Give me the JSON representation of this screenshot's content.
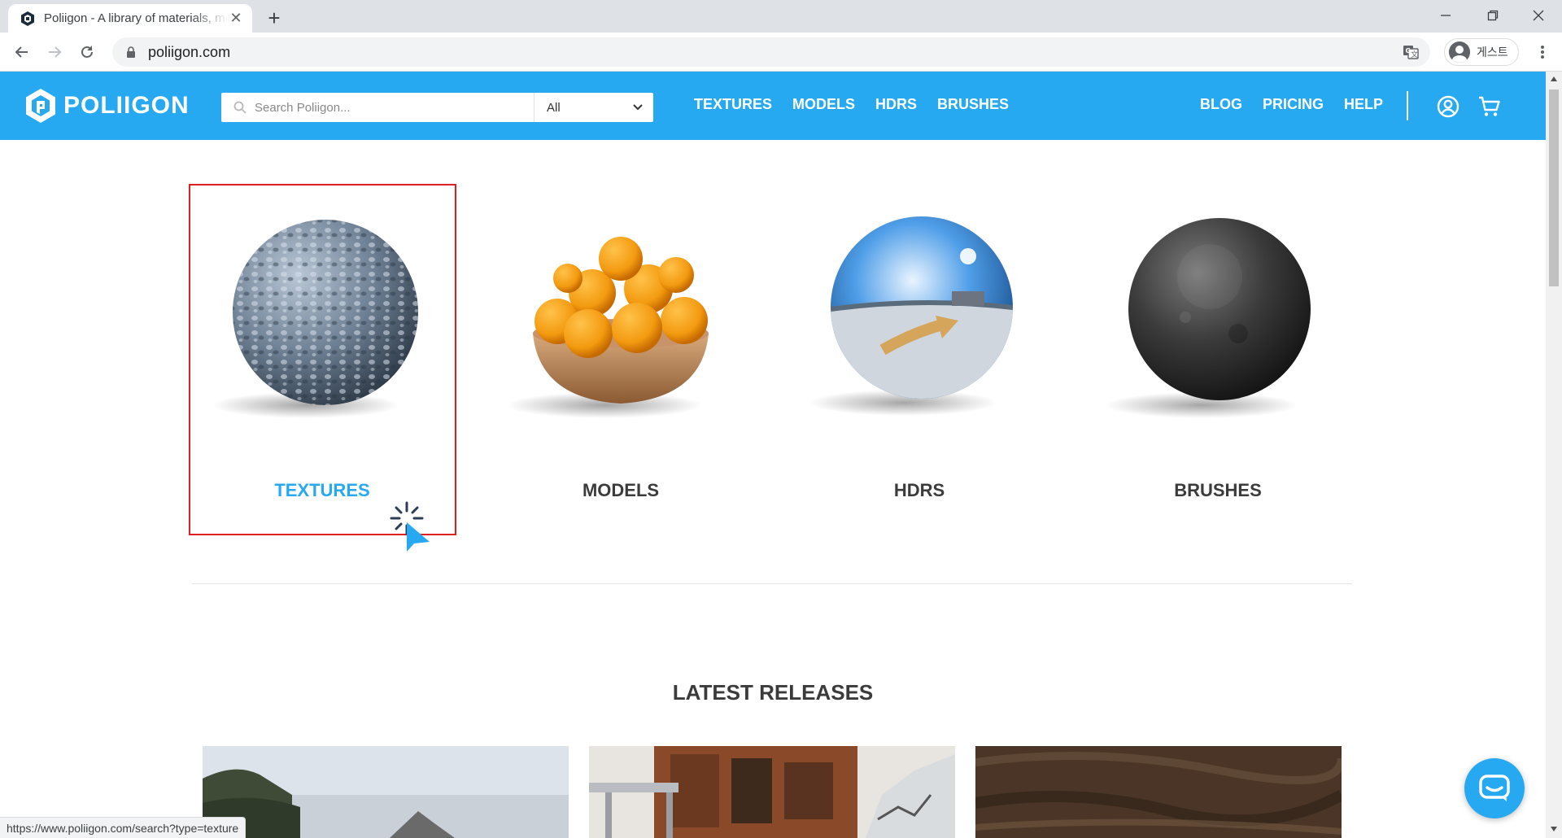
{
  "browser": {
    "tab_title": "Poliigon - A library of materials, models and HDRs",
    "url": "poliigon.com",
    "profile_label": "게스트",
    "status_url": "https://www.poliigon.com/search?type=texture"
  },
  "site": {
    "brand": "POLIIGON",
    "brand_color": "#27a9f1",
    "search": {
      "placeholder": "Search Poliigon...",
      "filter_value": "All"
    },
    "nav_main": [
      "TEXTURES",
      "MODELS",
      "HDRS",
      "BRUSHES"
    ],
    "nav_secondary": [
      "BLOG",
      "PRICING",
      "HELP"
    ],
    "icons": [
      "account-icon",
      "cart-icon"
    ]
  },
  "categories": [
    {
      "label": "TEXTURES",
      "active": true
    },
    {
      "label": "MODELS",
      "active": false
    },
    {
      "label": "HDRS",
      "active": false
    },
    {
      "label": "BRUSHES",
      "active": false
    }
  ],
  "latest": {
    "title": "LATEST RELEASES"
  }
}
